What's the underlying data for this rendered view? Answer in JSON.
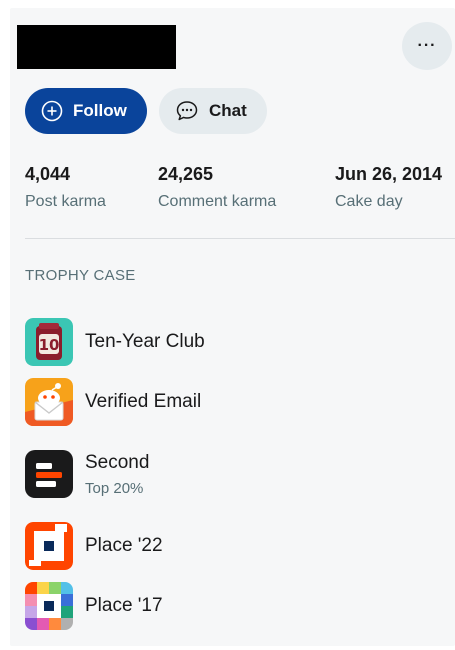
{
  "header": {
    "more_label": "···"
  },
  "actions": {
    "follow_label": "Follow",
    "chat_label": "Chat"
  },
  "stats": [
    {
      "value": "4,044",
      "label": "Post karma"
    },
    {
      "value": "24,265",
      "label": "Comment karma"
    },
    {
      "value": "Jun 26, 2014",
      "label": "Cake day"
    }
  ],
  "trophy_case": {
    "title": "TROPHY CASE",
    "items": [
      {
        "name": "Ten-Year Club",
        "icon": "ten-year-club-icon"
      },
      {
        "name": "Verified Email",
        "icon": "verified-email-icon"
      },
      {
        "name": "Second",
        "sub": "Top 20%",
        "icon": "second-icon"
      },
      {
        "name": "Place '22",
        "icon": "place-22-icon"
      },
      {
        "name": "Place '17",
        "icon": "place-17-icon"
      }
    ]
  },
  "colors": {
    "follow_bg": "#0a449b",
    "chip_bg": "#e5ebee",
    "muted_text": "#576f76"
  }
}
